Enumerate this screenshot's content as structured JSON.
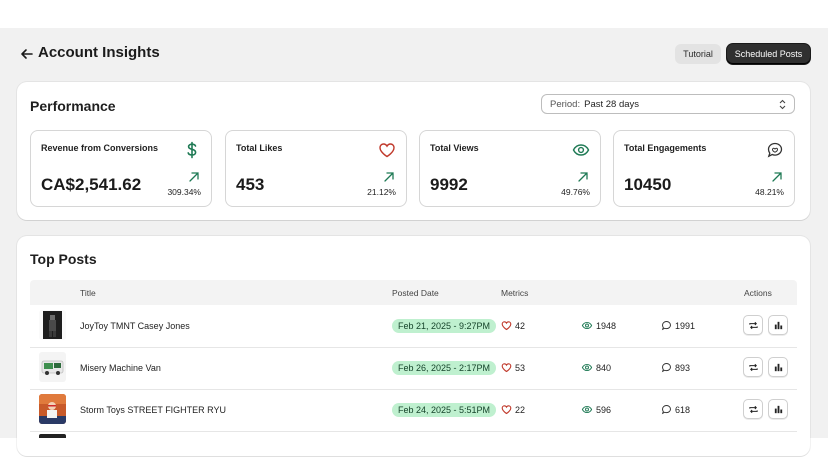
{
  "header": {
    "title": "Account Insights",
    "tutorial_label": "Tutorial",
    "scheduled_label": "Scheduled Posts"
  },
  "performance": {
    "title": "Performance",
    "period_label": "Period:",
    "period_value": "Past 28 days",
    "metrics": [
      {
        "label": "Revenue from Conversions",
        "value": "CA$2,541.62",
        "change": "309.34%",
        "icon": "dollar-icon"
      },
      {
        "label": "Total Likes",
        "value": "453",
        "change": "21.12%",
        "icon": "heart-icon"
      },
      {
        "label": "Total Views",
        "value": "9992",
        "change": "49.76%",
        "icon": "eye-icon"
      },
      {
        "label": "Total Engagements",
        "value": "10450",
        "change": "48.21%",
        "icon": "chat-icon"
      }
    ]
  },
  "top_posts": {
    "title": "Top Posts",
    "columns": {
      "title": "Title",
      "posted_date": "Posted Date",
      "metrics": "Metrics",
      "actions": "Actions"
    },
    "rows": [
      {
        "title": "JoyToy TMNT Casey Jones",
        "date": "Feb 21, 2025 - 9:27PM",
        "likes": "42",
        "views": "1948",
        "comments": "1991"
      },
      {
        "title": "Misery Machine Van",
        "date": "Feb 26, 2025 - 2:17PM",
        "likes": "53",
        "views": "840",
        "comments": "893"
      },
      {
        "title": "Storm Toys STREET FIGHTER RYU",
        "date": "Feb 24, 2025 - 5:51PM",
        "likes": "22",
        "views": "596",
        "comments": "618"
      }
    ]
  },
  "colors": {
    "accent_green": "#1f7a55",
    "heart_red": "#c0392b",
    "date_badge": "#bff0cf",
    "dark_button": "#303030"
  }
}
